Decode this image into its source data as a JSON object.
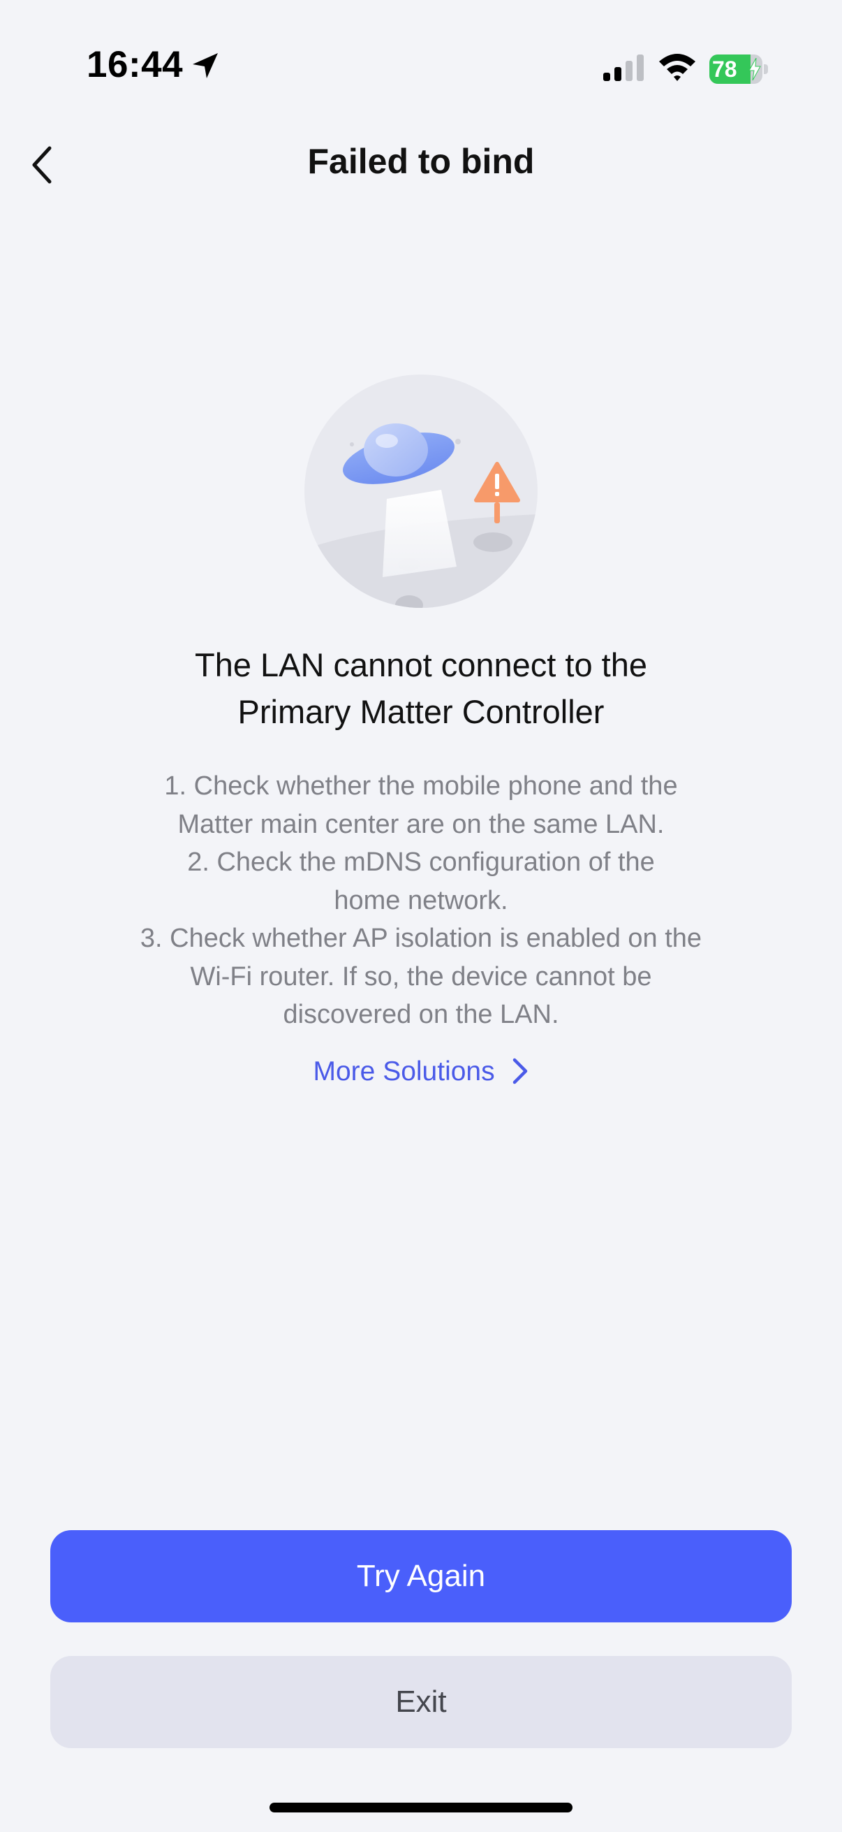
{
  "status_bar": {
    "time": "16:44",
    "battery_level": "78",
    "battery_fraction": 0.78,
    "icons": [
      "location-arrow-icon",
      "cellular-signal-icon",
      "wifi-icon",
      "battery-charging-icon"
    ]
  },
  "header": {
    "title": "Failed to bind",
    "back_icon": "chevron-left-icon"
  },
  "illustration": {
    "icon": "ufo-warning-illustration"
  },
  "content": {
    "headline_line1": "The LAN cannot connect to the",
    "headline_line2": "Primary Matter Controller",
    "tips": [
      "1. Check whether the mobile phone and the",
      "Matter main center are on the same LAN.",
      "2. Check the mDNS configuration of the",
      "home network.",
      "3. Check whether AP isolation is enabled on the",
      "Wi-Fi router. If so, the device cannot be",
      "discovered on the LAN."
    ],
    "more_solutions_label": "More Solutions"
  },
  "actions": {
    "try_again_label": "Try Again",
    "exit_label": "Exit"
  },
  "colors": {
    "background": "#f3f4f8",
    "primary": "#4a5ffb",
    "link": "#4a5ae8",
    "secondary_button": "#e2e3ee",
    "muted_text": "#7f8087",
    "battery_green": "#34c759"
  }
}
